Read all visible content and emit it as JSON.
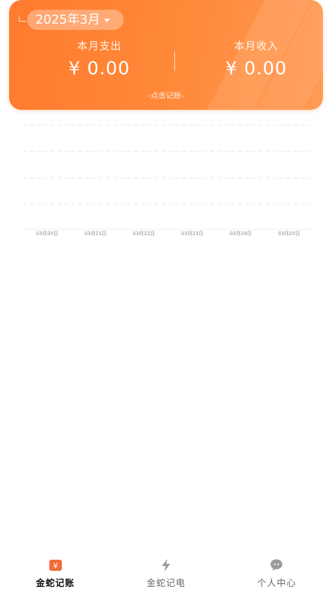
{
  "header": {
    "month": "2025年3月",
    "expense_label": "本月支出",
    "expense_value": "¥ 0.00",
    "income_label": "本月收入",
    "income_value": "¥ 0.00",
    "record_link": "-点击记账-"
  },
  "chart_data": {
    "type": "line",
    "categories": [
      "03月20日",
      "03月21日",
      "03月22日",
      "03月23日",
      "03月24日",
      "03月25日"
    ],
    "series": [],
    "grid": true
  },
  "colors": {
    "accent": "#ff7a2e",
    "active_icon": "#f26b3a",
    "inactive_icon": "#9a9a9a"
  },
  "tabs": [
    {
      "label": "金蛇记账",
      "icon": "yen-ticket-icon",
      "active": true
    },
    {
      "label": "金蛇记电",
      "icon": "lightning-icon",
      "active": false
    },
    {
      "label": "个人中心",
      "icon": "chat-bubble-icon",
      "active": false
    }
  ]
}
